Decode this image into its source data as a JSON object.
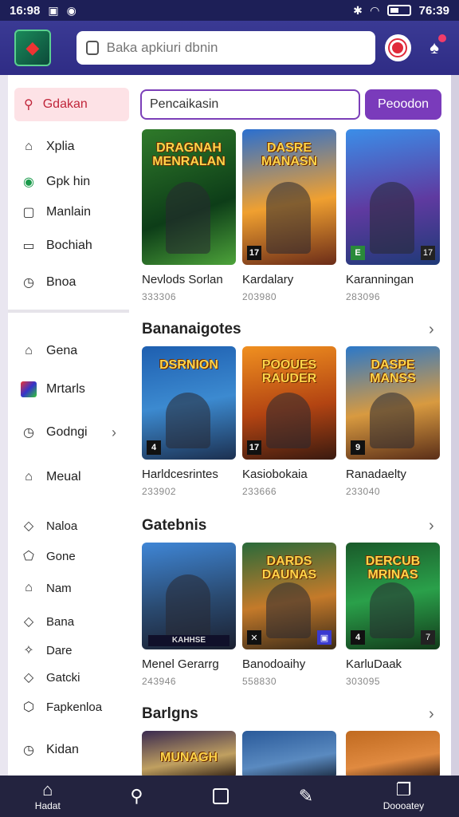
{
  "status_bar": {
    "time_left": "16:98",
    "time_right": "76:39"
  },
  "search": {
    "placeholder": "Baka apkiuri dbnin"
  },
  "sidebar": {
    "active": {
      "label": "Gdakan"
    },
    "items": [
      {
        "label": "Xplia",
        "icon": "home-icon"
      },
      {
        "label": "Gpk hin",
        "icon": "circle-badge-icon"
      },
      {
        "label": "Manlain",
        "icon": "square-icon"
      },
      {
        "label": "Bochiah",
        "icon": "chat-icon"
      },
      {
        "label": "Bnoa",
        "icon": "clock-icon"
      },
      {
        "label": "Gena",
        "icon": "home-icon"
      },
      {
        "label": "Mrtarls",
        "icon": "app-icon"
      },
      {
        "label": "Godngi",
        "icon": "clock-icon"
      },
      {
        "label": "Meual",
        "icon": "home-icon"
      },
      {
        "label": "Naloa",
        "icon": "diamond-icon"
      },
      {
        "label": "Gone",
        "icon": "pentagon-icon"
      },
      {
        "label": "Nam",
        "icon": "home-icon"
      },
      {
        "label": "Bana",
        "icon": "diamond-icon"
      },
      {
        "label": "Dare",
        "icon": "star-icon"
      },
      {
        "label": "Gatcki",
        "icon": "diamond-icon"
      },
      {
        "label": "Fapkenloa",
        "icon": "shield-icon"
      },
      {
        "label": "Kidan",
        "icon": "clock-icon"
      }
    ]
  },
  "filter": {
    "value": "Pencaikasin",
    "button": "Peoodon"
  },
  "sections": [
    {
      "title": "",
      "cards": [
        {
          "thumb_title": "DRAGNAH MENRALAN",
          "title": "Nevlods Sorlan",
          "count": "333306",
          "badge": ""
        },
        {
          "thumb_title": "DASRE MANASN",
          "title": "Kardalary",
          "count": "203980",
          "badge": "17"
        },
        {
          "thumb_title": "",
          "title": "Karanningan",
          "count": "283096",
          "badge": ""
        }
      ]
    },
    {
      "title": "Bananaigotes",
      "cards": [
        {
          "thumb_title": "DSRNION",
          "title": "Harldcesrintes",
          "count": "233902",
          "badge": ""
        },
        {
          "thumb_title": "POOUES RAUDER",
          "title": "Kasiobokaia",
          "count": "233666",
          "badge": "17"
        },
        {
          "thumb_title": "DASPE MANSS",
          "title": "Ranadaelty",
          "count": "233040",
          "badge": "9"
        }
      ]
    },
    {
      "title": "Gatebnis",
      "cards": [
        {
          "thumb_title": "KAHHSE",
          "title": "Menel Gerarrg",
          "count": "243946",
          "badge": ""
        },
        {
          "thumb_title": "DARDS DAUNAS",
          "title": "Banodoaihy",
          "count": "558830",
          "badge": ""
        },
        {
          "thumb_title": "DERCUB MRINAS",
          "title": "KarluDaak",
          "count": "303095",
          "badge": ""
        }
      ]
    },
    {
      "title": "Barlgns",
      "cards": [
        {
          "thumb_title": "MUNAGH",
          "title": "",
          "count": "",
          "badge": ""
        },
        {
          "thumb_title": "",
          "title": "",
          "count": "",
          "badge": ""
        },
        {
          "thumb_title": "",
          "title": "",
          "count": "",
          "badge": ""
        }
      ]
    }
  ],
  "bottom_nav": [
    {
      "label": "Hadat",
      "icon": "home-icon"
    },
    {
      "label": "",
      "icon": "search-icon"
    },
    {
      "label": "",
      "icon": "square-icon"
    },
    {
      "label": "",
      "icon": "edit-icon"
    },
    {
      "label": "Doooatey",
      "icon": "window-icon"
    }
  ]
}
